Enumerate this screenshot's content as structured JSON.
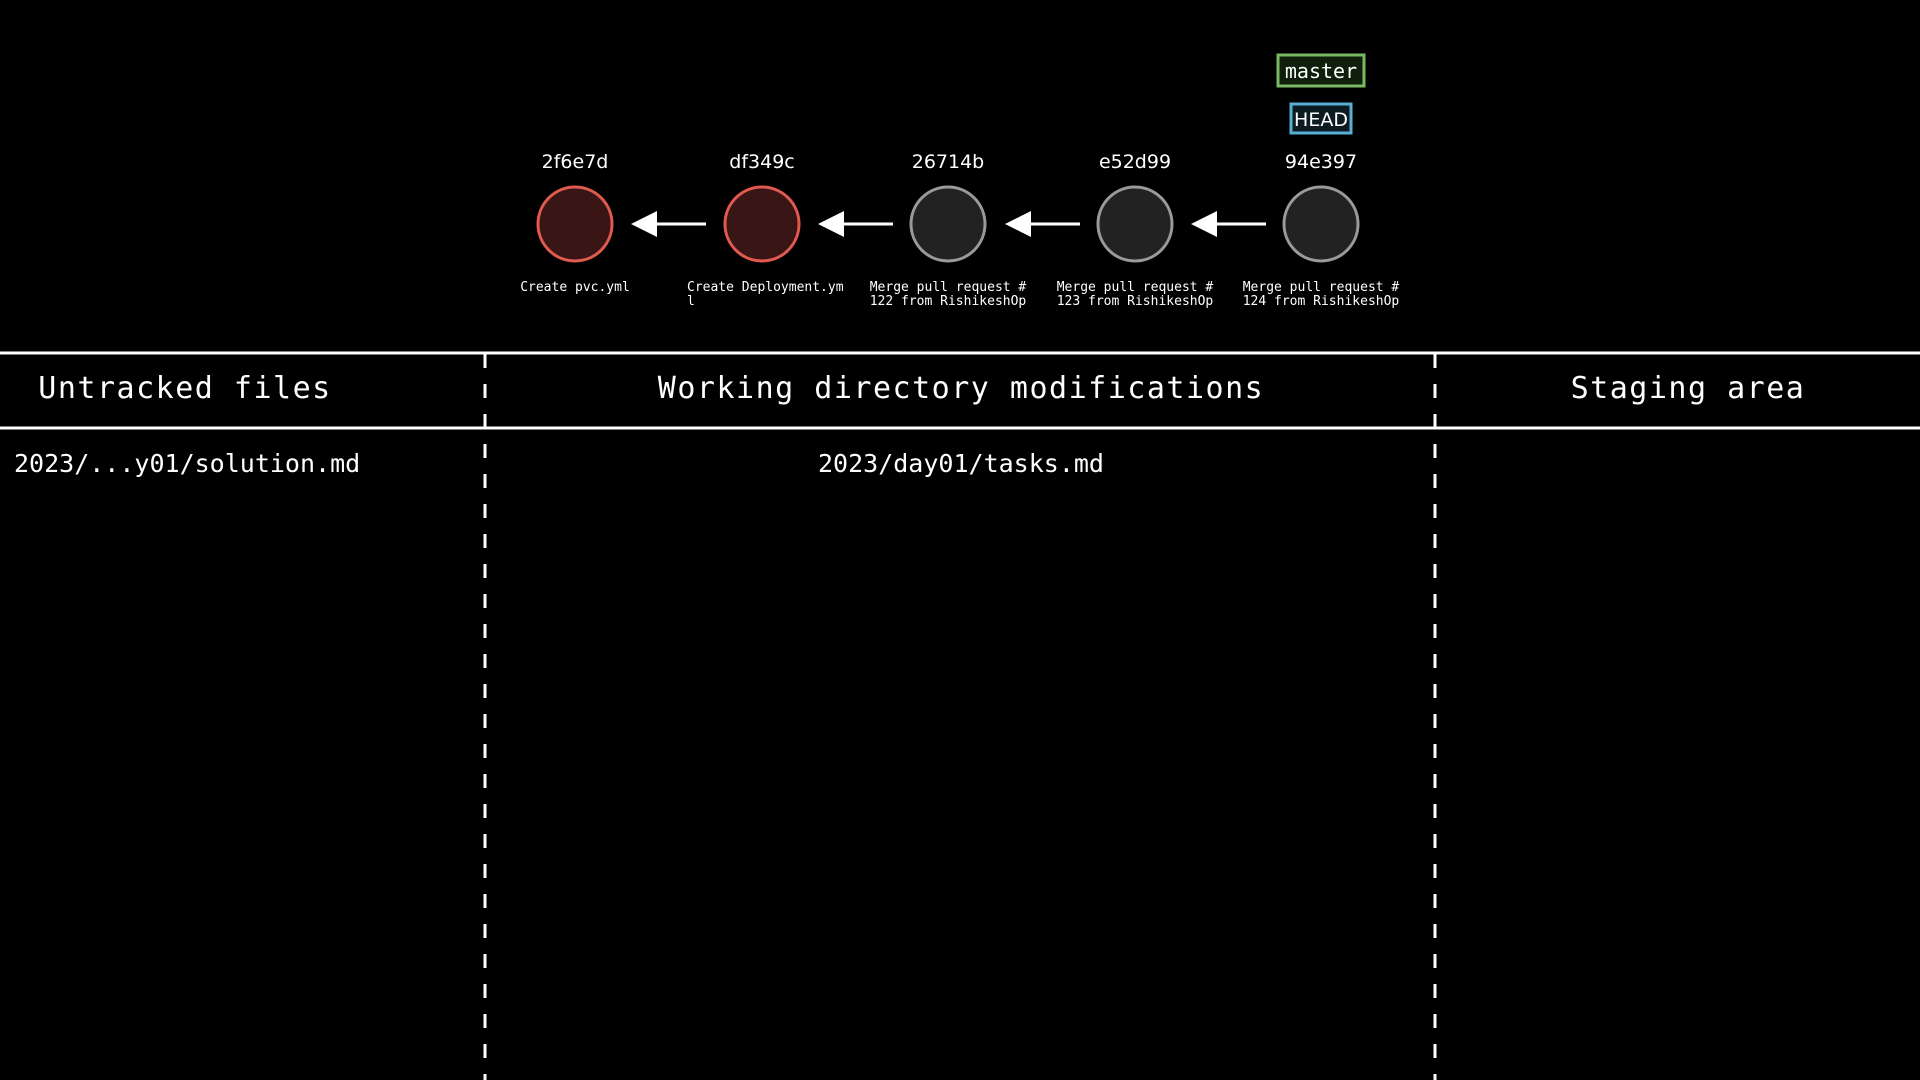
{
  "branch": {
    "label": "master",
    "color": "#7ab864"
  },
  "head": {
    "label": "HEAD",
    "color": "#5aaed4"
  },
  "commits": [
    {
      "hash": "2f6e7d",
      "message_lines": [
        "Create pvc.yml"
      ],
      "fill": "#3a1515",
      "stroke": "#e05a50"
    },
    {
      "hash": "df349c",
      "message_lines": [
        "Create Deployment.ym",
        "l"
      ],
      "fill": "#3a1515",
      "stroke": "#e05a50"
    },
    {
      "hash": "26714b",
      "message_lines": [
        "Merge pull request #",
        "122 from RishikeshOp"
      ],
      "fill": "#222222",
      "stroke": "#9a9a9a"
    },
    {
      "hash": "e52d99",
      "message_lines": [
        "Merge pull request #",
        "123 from RishikeshOp"
      ],
      "fill": "#222222",
      "stroke": "#9a9a9a"
    },
    {
      "hash": "94e397",
      "message_lines": [
        "Merge pull request #",
        "124 from RishikeshOp"
      ],
      "fill": "#222222",
      "stroke": "#9a9a9a"
    }
  ],
  "columns": {
    "untracked": {
      "title": "Untracked files",
      "files": [
        "2023/...y01/solution.md"
      ]
    },
    "working": {
      "title": "Working directory modifications",
      "files": [
        "2023/day01/tasks.md"
      ]
    },
    "staging": {
      "title": "Staging area",
      "files": []
    }
  }
}
